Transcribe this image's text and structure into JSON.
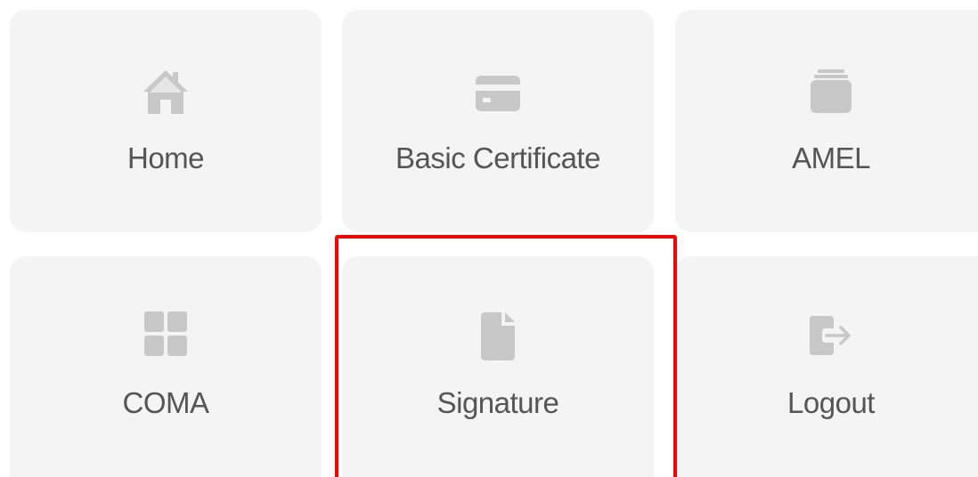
{
  "menu": {
    "tiles": [
      {
        "label": "Home",
        "icon": "home-icon"
      },
      {
        "label": "Basic Certificate",
        "icon": "id-card-icon"
      },
      {
        "label": "AMEL",
        "icon": "archive-icon"
      },
      {
        "label": "COMA",
        "icon": "grid-icon"
      },
      {
        "label": "Signature",
        "icon": "file-icon"
      },
      {
        "label": "Logout",
        "icon": "logout-icon"
      }
    ]
  },
  "colors": {
    "tile_bg": "#f4f4f4",
    "icon": "#c8c8c8",
    "label": "#555555",
    "highlight": "#ff0000"
  }
}
